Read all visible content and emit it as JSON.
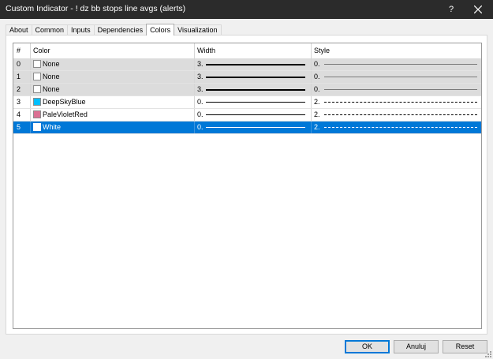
{
  "window": {
    "title": "Custom Indicator - ! dz bb stops line avgs (alerts)",
    "help_label": "?"
  },
  "tabs": [
    {
      "label": "About"
    },
    {
      "label": "Common"
    },
    {
      "label": "Inputs"
    },
    {
      "label": "Dependencies"
    },
    {
      "label": "Colors"
    },
    {
      "label": "Visualization"
    }
  ],
  "active_tab": "Colors",
  "table": {
    "headers": {
      "num": "#",
      "color": "Color",
      "width": "Width",
      "style": "Style"
    },
    "rows": [
      {
        "num": "0",
        "color": "None",
        "swatch": "#ffffff",
        "width": "3.",
        "width_level": 3,
        "style": "0.",
        "style_pattern": "solid-thin",
        "selected": false
      },
      {
        "num": "1",
        "color": "None",
        "swatch": "#ffffff",
        "width": "3.",
        "width_level": 3,
        "style": "0.",
        "style_pattern": "solid-thin",
        "selected": false
      },
      {
        "num": "2",
        "color": "None",
        "swatch": "#ffffff",
        "width": "3.",
        "width_level": 3,
        "style": "0.",
        "style_pattern": "solid-thin",
        "selected": false
      },
      {
        "num": "3",
        "color": "DeepSkyBlue",
        "swatch": "#00bfff",
        "width": "0.",
        "width_level": 1,
        "style": "2.",
        "style_pattern": "dashed",
        "selected": false
      },
      {
        "num": "4",
        "color": "PaleVioletRed",
        "swatch": "#db7093",
        "width": "0.",
        "width_level": 1,
        "style": "2.",
        "style_pattern": "dashed",
        "selected": false
      },
      {
        "num": "5",
        "color": "White",
        "swatch": "#ffffff",
        "width": "0.",
        "width_level": 1,
        "style": "2.",
        "style_pattern": "dashed",
        "selected": true
      }
    ]
  },
  "buttons": {
    "ok": "OK",
    "cancel": "Anuluj",
    "reset": "Reset"
  },
  "colors": {
    "titlebar": "#2b2b2b",
    "selection": "#0078d7",
    "row_gray": "#dcdcdc"
  }
}
